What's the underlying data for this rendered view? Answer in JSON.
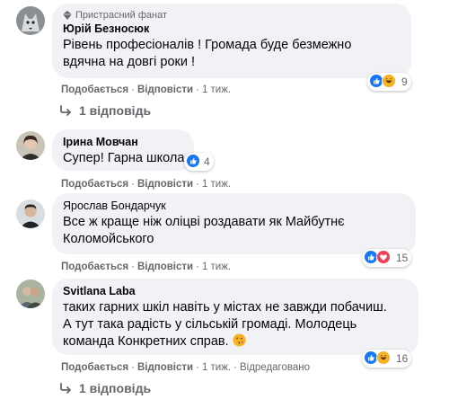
{
  "comments": [
    {
      "badge": "Пристрасний фанат",
      "author": "Юрій Безносюк",
      "lines": [
        "Рівень професіоналів ! Громада буде безмежно",
        "вдячна на довгі роки !"
      ],
      "like": "Подобається",
      "reply": "Відповісти",
      "time": "1 тиж.",
      "reaction_count": "9",
      "replies": "1 відповідь"
    },
    {
      "author": "Ірина Мовчан",
      "lines": [
        "Супер! Гарна школа"
      ],
      "like": "Подобається",
      "reply": "Відповісти",
      "time": "1 тиж.",
      "reaction_count": "4"
    },
    {
      "author": "Ярослав Бондарчук",
      "lines": [
        "Все ж краще ніж оліцві роздавати як Майбутнє",
        "Коломойського"
      ],
      "like": "Подобається",
      "reply": "Відповісти",
      "time": "1 тиж.",
      "reaction_count": "15"
    },
    {
      "author": "Svitlana Laba",
      "lines": [
        "таких гарних шкіл навіть у містах не завжди побачиш.",
        "А тут така радість у сільській громаді. Молодець",
        "команда Конкретних справ."
      ],
      "like": "Подобається",
      "reply": "Відповісти",
      "time": "1 тиж.",
      "edited": "Відредаговано",
      "reaction_count": "16",
      "replies": "1 відповідь"
    }
  ],
  "colors": {
    "bubble": "#f0f2f5",
    "meta": "#65676b",
    "like_blue": "#1877f2",
    "love_red": "#f33e58",
    "haha_yellow": "#f7b125"
  }
}
